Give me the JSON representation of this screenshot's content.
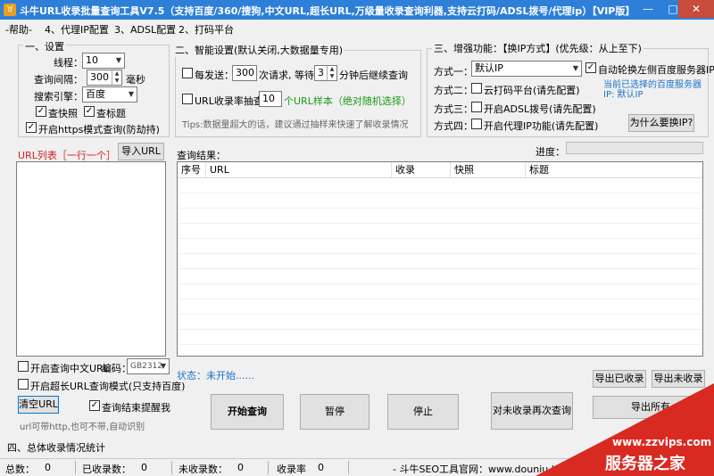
{
  "window": {
    "title": "斗牛URL收录批量查询工具V7.5（支持百度/360/搜狗,中文URL,超长URL,万级量收录查询利器,支持云打码/ADSL拨号/代理ip）【VIP版】",
    "minimize": "—",
    "maximize": "□",
    "close": "✕"
  },
  "menu": [
    "-帮助-",
    "4、代理IP配置",
    "3、ADSL配置",
    "2、打码平台"
  ],
  "settings": {
    "title": "一、设置",
    "threads_label": "线程：",
    "threads_value": "10",
    "interval_label": "查询间隔：",
    "interval_value": "300",
    "interval_unit": "毫秒",
    "engine_label": "搜索引擎：",
    "engine_value": "百度",
    "check_snapshot": "查快照",
    "check_title": "查标题",
    "https_mode": "开启https模式查询(防劫持)"
  },
  "smart": {
    "title": "二、智能设置(默认关闭,大数据量专用)",
    "every_send": "每发送：",
    "every_send_value": "300",
    "wait_label": "次请求, 等待：",
    "wait_value": "3",
    "wait_unit": "分钟后继续查询",
    "sample_label": "URL收录率抽查：",
    "sample_value": "10",
    "sample_hint": "个URL样本（绝对随机选择）",
    "tips": "Tips:数据量超大的话，建议通过抽样来快速了解收录情况"
  },
  "enhance": {
    "title": "三、增强功能：【换IP方式】(优先级：从上至下)",
    "method1_label": "方式一：",
    "method1_value": "默认IP",
    "auto_switch": "自动轮换左侧百度服务器IP",
    "current_ip_line1": "当前已选择的百度服务器",
    "current_ip_line2": "IP:  默认IP",
    "method2_label": "方式二：",
    "method2_text": "云打码平台(请先配置)",
    "method3_label": "方式三：",
    "method3_text": "开启ADSL拨号(请先配置)",
    "method4_label": "方式四：",
    "method4_text": "开启代理IP功能(请先配置)",
    "why_button": "为什么要换IP?"
  },
  "url_list": {
    "label": "URL列表［一行一个］",
    "import_button": "导入URL",
    "chinese_url": "开启查询中文URL",
    "encoding_label": "编码：",
    "encoding_value": "GB2312",
    "long_url": "开启超长URL查询模式(只支持百度)",
    "clear_button": "清空URL",
    "remind": "查询结束提醒我",
    "hint": "url可带http,也可不带,自动识别"
  },
  "results": {
    "label": "查询结果：",
    "progress_label": "进度：",
    "progress": 0,
    "columns": [
      "序号",
      "URL",
      "收录",
      "快照",
      "标题"
    ],
    "status": "状态：未开始......",
    "export_indexed": "导出已收录",
    "export_unindexed": "导出未收录",
    "export_all": "导出所有"
  },
  "actions": {
    "start": "开始查询",
    "pause": "暂停",
    "stop": "停止",
    "requery": "对未收录再次查询"
  },
  "stats": {
    "title": "四、总体收录情况统计",
    "total_label": "总数：",
    "total": "0",
    "indexed_label": "已收录数：",
    "indexed": "0",
    "unindexed_label": "未收录数：",
    "unindexed": "0",
    "rate_label": "收录率",
    "rate": "0",
    "footer": "- 斗牛SEO工具官网：www.douniu.la"
  },
  "watermark": {
    "url": "www.zzvips.com",
    "brand": "服务器之家"
  },
  "colors": {
    "titlebar": "#2d7fd8",
    "red_label": "#d42020",
    "green_hint": "#1a9a1a",
    "blue_info": "#1a73c8",
    "watermark": "#d82a20"
  }
}
